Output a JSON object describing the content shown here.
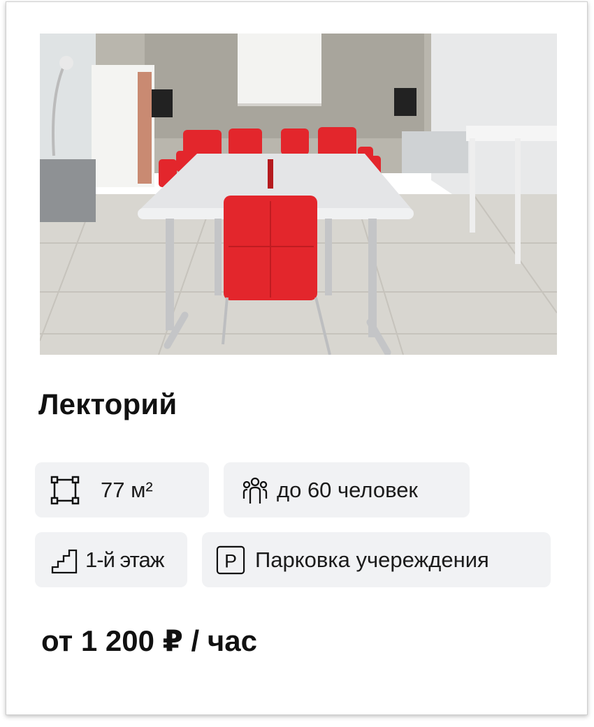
{
  "room": {
    "title": "Лекторий",
    "image_alt": "Лекторий — зал с белым столом и красными стульями"
  },
  "features": {
    "area": {
      "icon": "area-frame-icon",
      "label": "77 м²"
    },
    "capacity": {
      "icon": "people-icon",
      "label": "до 60 человек"
    },
    "floor": {
      "icon": "stairs-icon",
      "label": "1-й этаж"
    },
    "parking": {
      "icon": "parking-icon",
      "label": "Парковка учереждения"
    }
  },
  "price": {
    "label": "от 1 200 ₽ / час"
  },
  "colors": {
    "chip_bg": "#f1f2f4",
    "chair_red": "#e3262c",
    "text": "#111111"
  }
}
